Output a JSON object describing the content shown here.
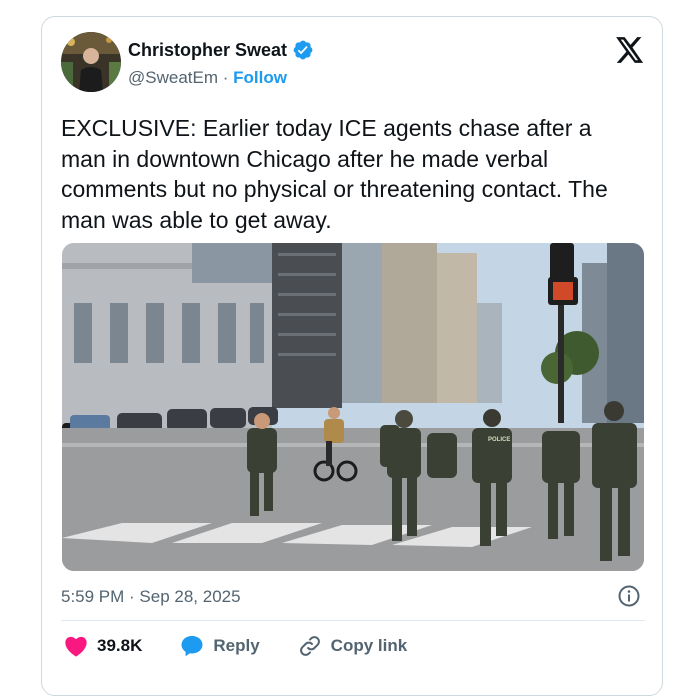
{
  "author": {
    "name": "Christopher Sweat",
    "handle": "@SweatEm",
    "separator": "·",
    "follow_label": "Follow"
  },
  "tweet": {
    "text": "EXCLUSIVE: Earlier today ICE agents chase after a man in downtown Chicago after he made verbal comments but no physical or threatening contact. The man was able to get away.",
    "timestamp": "5:59 PM · Sep 28, 2025"
  },
  "media": {
    "sign_text": "POLICE"
  },
  "actions": {
    "like_count": "39.8K",
    "reply_label": "Reply",
    "copy_link_label": "Copy link"
  },
  "colors": {
    "accent": "#1d9bf0",
    "like": "#f91880",
    "text": "#0f1419",
    "muted": "#536471",
    "border": "#cfd9de"
  },
  "icons": [
    "verified-badge-icon",
    "x-logo-icon",
    "info-icon",
    "heart-icon",
    "reply-bubble-icon",
    "link-icon"
  ]
}
